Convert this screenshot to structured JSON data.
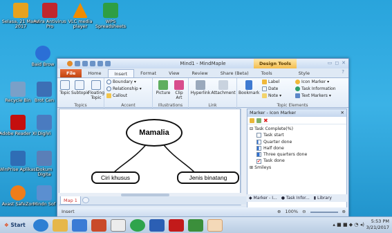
{
  "desktop": {
    "icons": [
      {
        "label": "Selasa, 21 Maret 2017",
        "color": "#e6a21f"
      },
      {
        "label": "Avira Antivirus Pro",
        "color": "#c1272d"
      },
      {
        "label": "VLC media player",
        "color": "#f08c00"
      },
      {
        "label": "WPS Spreadsheets",
        "color": "#2e9e44"
      },
      {
        "label": "Baid Brow",
        "color": "#2b6fd6"
      },
      {
        "label": "Recycle Bin",
        "color": "#7aa0c8"
      },
      {
        "label": "Brot Cen",
        "color": "#3c6fb5"
      },
      {
        "label": "Adobe Reader XI",
        "color": "#c40f0f"
      },
      {
        "label": "DigiVi",
        "color": "#4a7bc0"
      },
      {
        "label": "WinPrise Aplikasi",
        "color": "#2f6db5"
      },
      {
        "label": "Dokum Digita",
        "color": "#5a7fb8"
      },
      {
        "label": "Avast SafeZon",
        "color": "#ef7d1a"
      },
      {
        "label": "Mindn Sof",
        "color": "#5b8fd0"
      }
    ]
  },
  "window": {
    "title": "Mind1 - MindMaple",
    "context_tab": "Design Tools",
    "tabs": [
      "File",
      "Home",
      "Insert",
      "Format",
      "View",
      "Review",
      "Share (Beta)",
      "Tools",
      "Style"
    ],
    "active_tab": "Insert"
  },
  "ribbon": {
    "topics": {
      "label": "Topics",
      "buttons": [
        "Topic",
        "Subtopic",
        "Floating Topic"
      ]
    },
    "accent": {
      "label": "Accent",
      "items": [
        "Boundary",
        "Relationship",
        "Callout"
      ]
    },
    "illustrations": {
      "label": "Illustrations",
      "buttons": [
        "Picture",
        "Clip Art"
      ]
    },
    "link": {
      "label": "Link",
      "buttons": [
        "Hyperlink",
        "Attachment"
      ]
    },
    "bookmark": "Bookmark",
    "topic_elements": {
      "label": "Topic Elements",
      "items": [
        "Label",
        "Date",
        "Note",
        "Icon Marker",
        "Task Information",
        "Text Markers"
      ]
    }
  },
  "mindmap": {
    "central": "Mamalia",
    "children": [
      "Ciri khusus",
      "Jenis binatang"
    ]
  },
  "sheet": {
    "tab": "Map 1"
  },
  "status": {
    "mode": "Insert",
    "zoom": "100%"
  },
  "panel": {
    "title": "Marker - Icon Marker",
    "group": "Task Complete(%)",
    "items": [
      "Task start",
      "Quarter done",
      "Half done",
      "Three quarters done",
      "Task done"
    ],
    "next_group": "Smileys",
    "tabs": [
      "Marker - I...",
      "Task Infor...",
      "Library"
    ]
  },
  "taskbar": {
    "start": "Start",
    "time": "5:53 PM",
    "date": "3/21/2017"
  }
}
